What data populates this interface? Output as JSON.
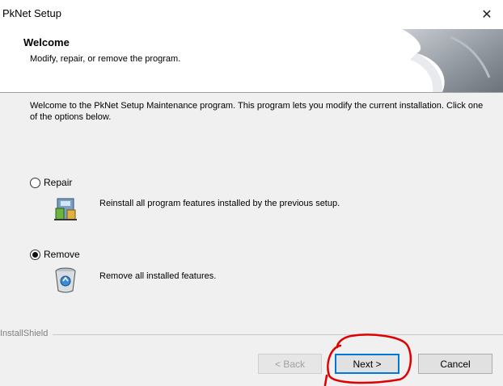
{
  "window": {
    "title": "PkNet Setup",
    "close_glyph": "✕"
  },
  "header": {
    "title": "Welcome",
    "subtitle": "Modify, repair, or remove the program."
  },
  "intro": "Welcome to the PkNet Setup Maintenance program. This program lets you modify the current installation. Click one of the options below.",
  "options": [
    {
      "label": "Repair",
      "description": "Reinstall all program features installed by the previous setup.",
      "selected": false,
      "icon": "repair-icon"
    },
    {
      "label": "Remove",
      "description": "Remove all installed features.",
      "selected": true,
      "icon": "remove-icon"
    }
  ],
  "footer": {
    "brand": "InstallShield",
    "back_label": "< Back",
    "next_label": "Next >",
    "cancel_label": "Cancel"
  },
  "colors": {
    "default_button_border": "#0078d7",
    "annotation": "#e00000"
  }
}
